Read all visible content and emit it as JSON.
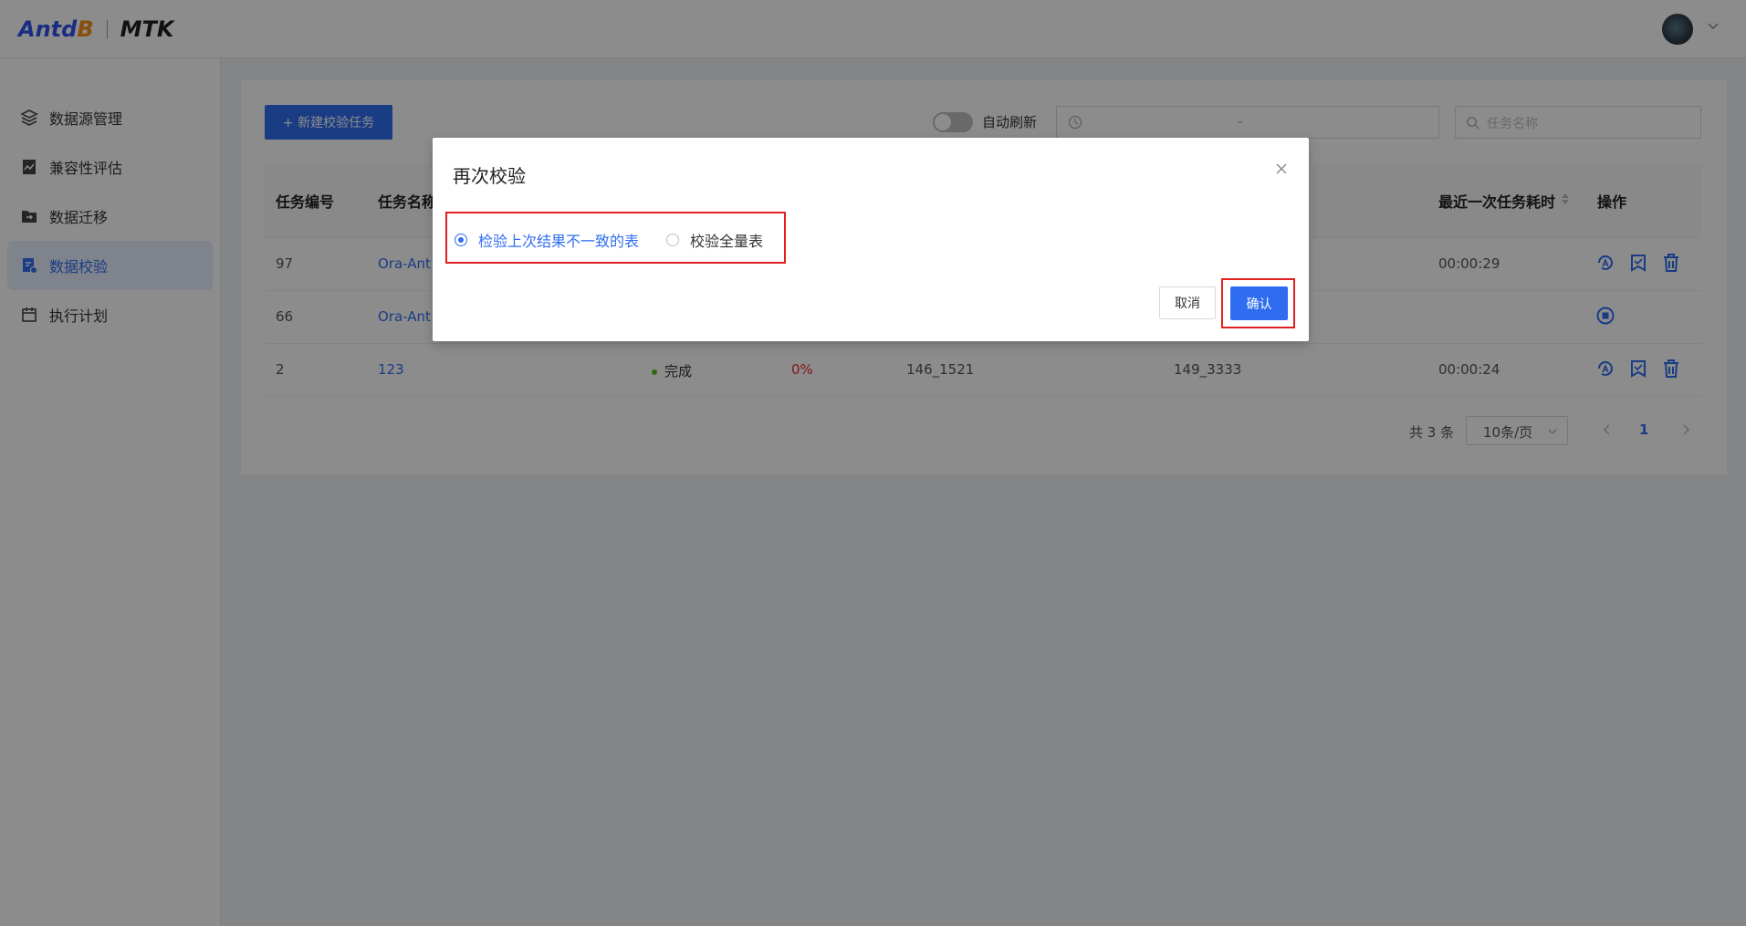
{
  "header": {
    "logo_left_a": "Antd",
    "logo_left_b": "B",
    "logo_right": "MTK"
  },
  "sidebar": {
    "items": [
      {
        "label": "数据源管理",
        "icon": "layers-icon"
      },
      {
        "label": "兼容性评估",
        "icon": "chart-icon"
      },
      {
        "label": "数据迁移",
        "icon": "folder-arrow-icon"
      },
      {
        "label": "数据校验",
        "icon": "document-check-icon",
        "active": true
      },
      {
        "label": "执行计划",
        "icon": "calendar-icon"
      }
    ]
  },
  "toolbar": {
    "new_task_label": "+ 新建校验任务",
    "auto_refresh_label": "自动刷新",
    "date_range_separator": "-",
    "search_placeholder": "任务名称"
  },
  "table": {
    "headers": {
      "id": "任务编号",
      "name": "任务名称",
      "last_duration": "最近一次任务耗时",
      "ops": "操作"
    },
    "rows": [
      {
        "id": "97",
        "name": "Ora-Ant",
        "status": "",
        "progress": "",
        "src": "",
        "dst": "",
        "duration": "00:00:29"
      },
      {
        "id": "66",
        "name": "Ora-Ant",
        "status": "",
        "progress": "",
        "src": "",
        "dst": "",
        "duration": ""
      },
      {
        "id": "2",
        "name": "123",
        "status": "完成",
        "progress": "0%",
        "src": "146_1521",
        "dst": "149_3333",
        "duration": "00:00:24"
      }
    ]
  },
  "pagination": {
    "total": "共 3 条",
    "page_size": "10条/页",
    "current": "1"
  },
  "modal": {
    "title": "再次校验",
    "options": [
      {
        "label": "检验上次结果不一致的表",
        "checked": true
      },
      {
        "label": "校验全量表",
        "checked": false
      }
    ],
    "cancel_label": "取消",
    "ok_label": "确认"
  },
  "colors": {
    "primary": "#2f6df0",
    "highlight": "#e02020",
    "success": "#52c41a",
    "danger": "#f5222d"
  }
}
